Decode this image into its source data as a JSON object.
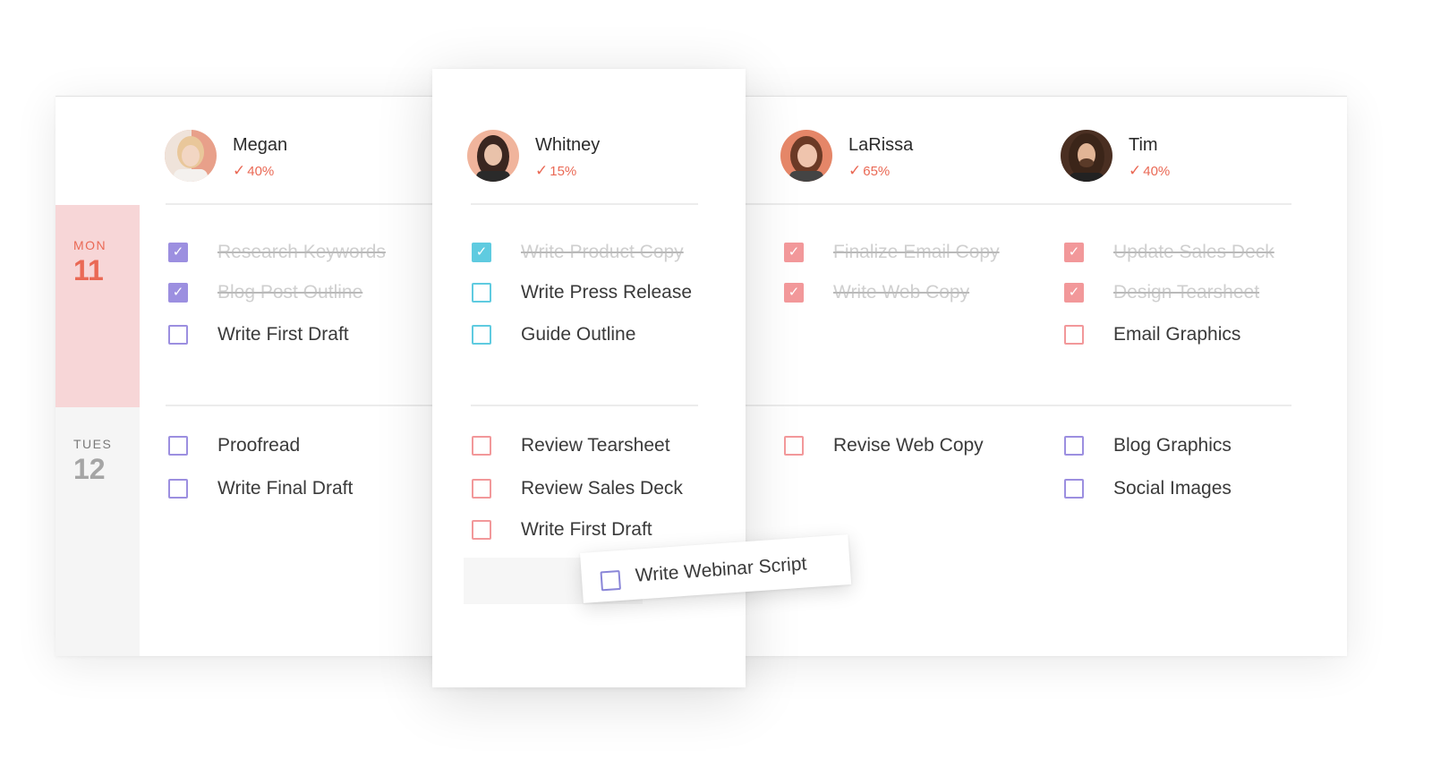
{
  "days": [
    {
      "name": "MON",
      "num": "11"
    },
    {
      "name": "TUES",
      "num": "12"
    }
  ],
  "people": [
    {
      "name": "Megan",
      "pct": "40%"
    },
    {
      "name": "Whitney",
      "pct": "15%"
    },
    {
      "name": "LaRissa",
      "pct": "65%"
    },
    {
      "name": "Tim",
      "pct": "40%"
    }
  ],
  "check_glyph": "✓",
  "colors": {
    "megan": "#9c8fe0",
    "whitney": "#5fcbe0",
    "larissa": "#f2989a",
    "tim": "#f2989a",
    "accent": "#ea6955"
  },
  "tasks": {
    "megan_mon": [
      {
        "label": "Research Keywords",
        "done": true
      },
      {
        "label": "Blog Post Outline",
        "done": true
      },
      {
        "label": "Write First Draft",
        "done": false
      }
    ],
    "megan_tue": [
      {
        "label": "Proofread",
        "done": false
      },
      {
        "label": "Write Final Draft",
        "done": false
      }
    ],
    "whitney_mon": [
      {
        "label": "Write Product Copy",
        "done": true
      },
      {
        "label": "Write Press Release",
        "done": false
      },
      {
        "label": "Guide Outline",
        "done": false
      }
    ],
    "whitney_tue": [
      {
        "label": "Review Tearsheet",
        "done": false
      },
      {
        "label": "Review Sales Deck",
        "done": false
      },
      {
        "label": "Write First Draft",
        "done": false
      }
    ],
    "larissa_mon": [
      {
        "label": "Finalize Email Copy",
        "done": true
      },
      {
        "label": "Write Web Copy",
        "done": true
      }
    ],
    "larissa_tue": [
      {
        "label": "Revise Web Copy",
        "done": false
      }
    ],
    "tim_mon": [
      {
        "label": "Update Sales Deck",
        "done": true
      },
      {
        "label": "Design Tearsheet",
        "done": true
      },
      {
        "label": "Email Graphics",
        "done": false
      }
    ],
    "tim_tue": [
      {
        "label": "Blog Graphics",
        "done": false
      },
      {
        "label": "Social Images",
        "done": false
      }
    ]
  },
  "dragging_task": {
    "label": "Write Webinar Script",
    "done": false
  }
}
